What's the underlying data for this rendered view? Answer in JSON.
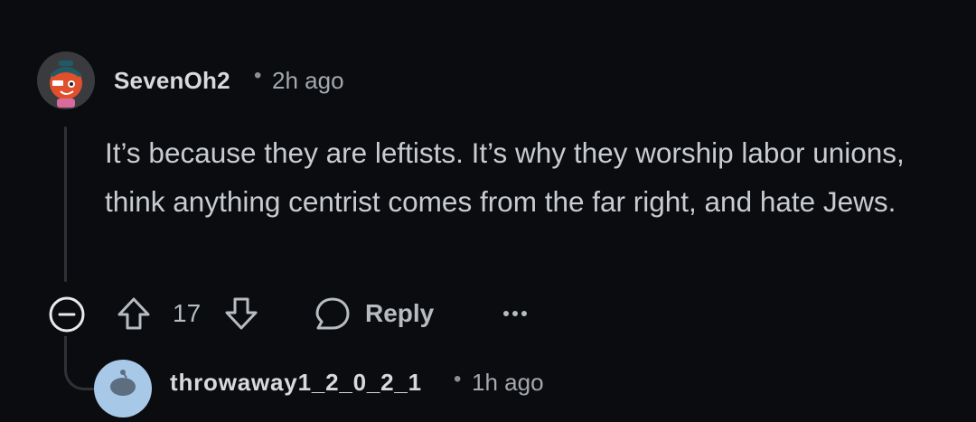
{
  "comment": {
    "username": "SevenOh2",
    "separator": "•",
    "timestamp": "2h ago",
    "body": "It’s because they are leftists. It’s why they worship labor unions, think anything centrist comes from the far right, and hate Jews.",
    "votes": "17",
    "reply_label": "Reply"
  },
  "child_comment": {
    "username": "throwaway1_2_0_2_1",
    "separator": "•",
    "timestamp": "1h ago"
  },
  "icons": {
    "collapse": "collapse-minus-icon",
    "upvote": "upvote-arrow-icon",
    "downvote": "downvote-arrow-icon",
    "reply": "speech-bubble-icon",
    "more": "more-dots-icon"
  },
  "colors": {
    "background": "#0b0c0f",
    "text": "#c8ccd0",
    "muted": "#a3a9ad",
    "child_avatar": "#a8c8e8"
  }
}
